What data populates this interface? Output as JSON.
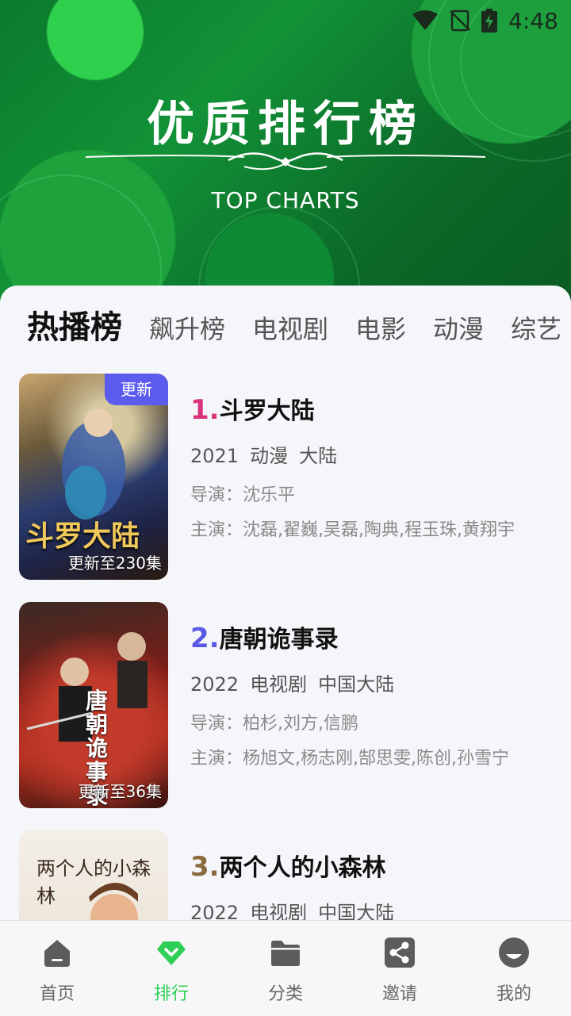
{
  "status_bar": {
    "time": "4:48"
  },
  "hero": {
    "title": "优质排行榜",
    "subtitle": "TOP CHARTS"
  },
  "tabs": [
    {
      "label": "热播榜",
      "active": true
    },
    {
      "label": "飙升榜"
    },
    {
      "label": "电视剧"
    },
    {
      "label": "电影"
    },
    {
      "label": "动漫"
    },
    {
      "label": "综艺"
    }
  ],
  "items": [
    {
      "rank": "1.",
      "rank_color": "#d9337a",
      "title": "斗罗大陆",
      "year": "2021",
      "type": "动漫",
      "region": "大陆",
      "director": "导演：沈乐平",
      "cast": "主演：沈磊,翟巍,吴磊,陶典,程玉珠,黄翔宇",
      "badge": "更新",
      "episodes": "更新至230集",
      "poster_text": "斗罗大陆"
    },
    {
      "rank": "2.",
      "rank_color": "#5a59e6",
      "title": "唐朝诡事录",
      "year": "2022",
      "type": "电视剧",
      "region": "中国大陆",
      "director": "导演：柏杉,刘方,信鹏",
      "cast": "主演：杨旭文,杨志刚,郜思雯,陈创,孙雪宁",
      "episodes": "更新至36集",
      "poster_text": "唐朝诡事录"
    },
    {
      "rank": "3.",
      "rank_color": "#8a6a3c",
      "title": "两个人的小森林",
      "year": "2022",
      "type": "电视剧",
      "region": "中国大陆",
      "poster_text": "两个人的小森林"
    }
  ],
  "nav": [
    {
      "label": "首页",
      "icon": "home-icon"
    },
    {
      "label": "排行",
      "icon": "ranking-icon",
      "active": true
    },
    {
      "label": "分类",
      "icon": "folder-icon"
    },
    {
      "label": "邀请",
      "icon": "share-icon"
    },
    {
      "label": "我的",
      "icon": "profile-icon"
    }
  ],
  "colors": {
    "accent": "#2fcf57",
    "badge": "#5b5bee"
  }
}
